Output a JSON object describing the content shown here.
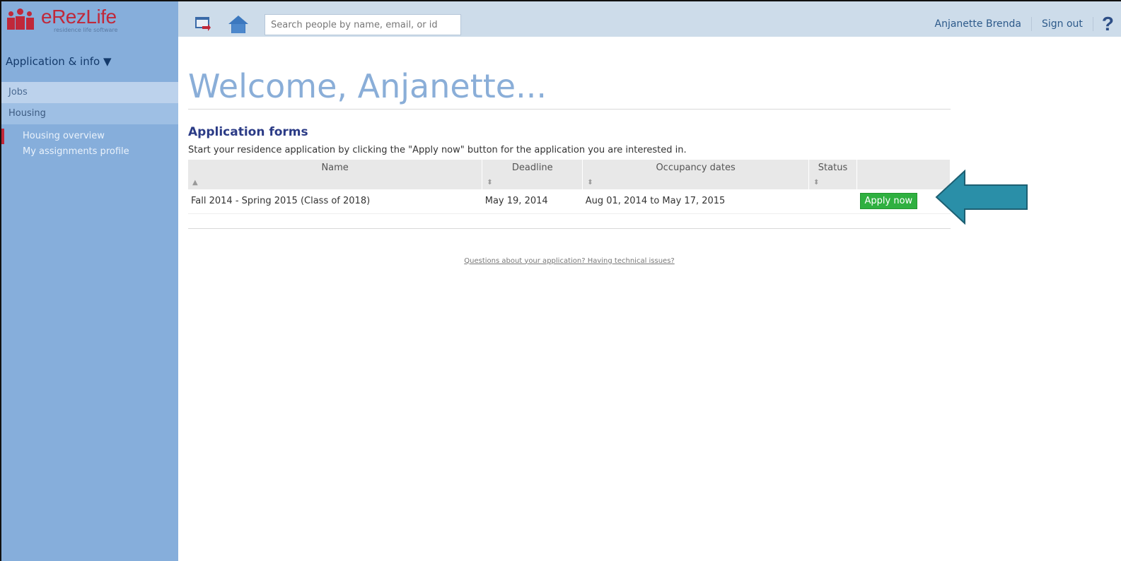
{
  "brand": {
    "name": "eRezLife",
    "tagline": "residence life software",
    "color": "#c0283a"
  },
  "sidebar": {
    "section_toggle": "Application & info ▼",
    "items": [
      {
        "label": "Jobs"
      },
      {
        "label": "Housing"
      }
    ],
    "sub_items": [
      {
        "label": "Housing overview",
        "active": true
      },
      {
        "label": "My assignments profile",
        "active": false
      }
    ]
  },
  "topbar": {
    "search_placeholder": "Search people by name, email, or id",
    "user_name": "Anjanette Brenda",
    "sign_out": "Sign out",
    "help": "?"
  },
  "main": {
    "welcome": "Welcome, Anjanette...",
    "section_title": "Application forms",
    "intro": "Start your residence application by clicking the \"Apply now\" button for the application you are interested in.",
    "table": {
      "headers": [
        "Name",
        "Deadline",
        "Occupancy dates",
        "Status",
        ""
      ],
      "sort_icons": [
        "▲",
        "⬍",
        "⬍",
        "⬍"
      ],
      "rows": [
        {
          "name": "Fall 2014 - Spring 2015 (Class of 2018)",
          "deadline": "May 19, 2014",
          "occupancy": "Aug 01, 2014 to May 17, 2015",
          "status": "",
          "action": "Apply now"
        }
      ]
    },
    "questions_link": "Questions about your application? Having technical issues?"
  },
  "colors": {
    "sidebar": "#86aedb",
    "topbar": "#cddcea",
    "apply_button": "#2fb040",
    "arrow": "#2a8fa8"
  }
}
